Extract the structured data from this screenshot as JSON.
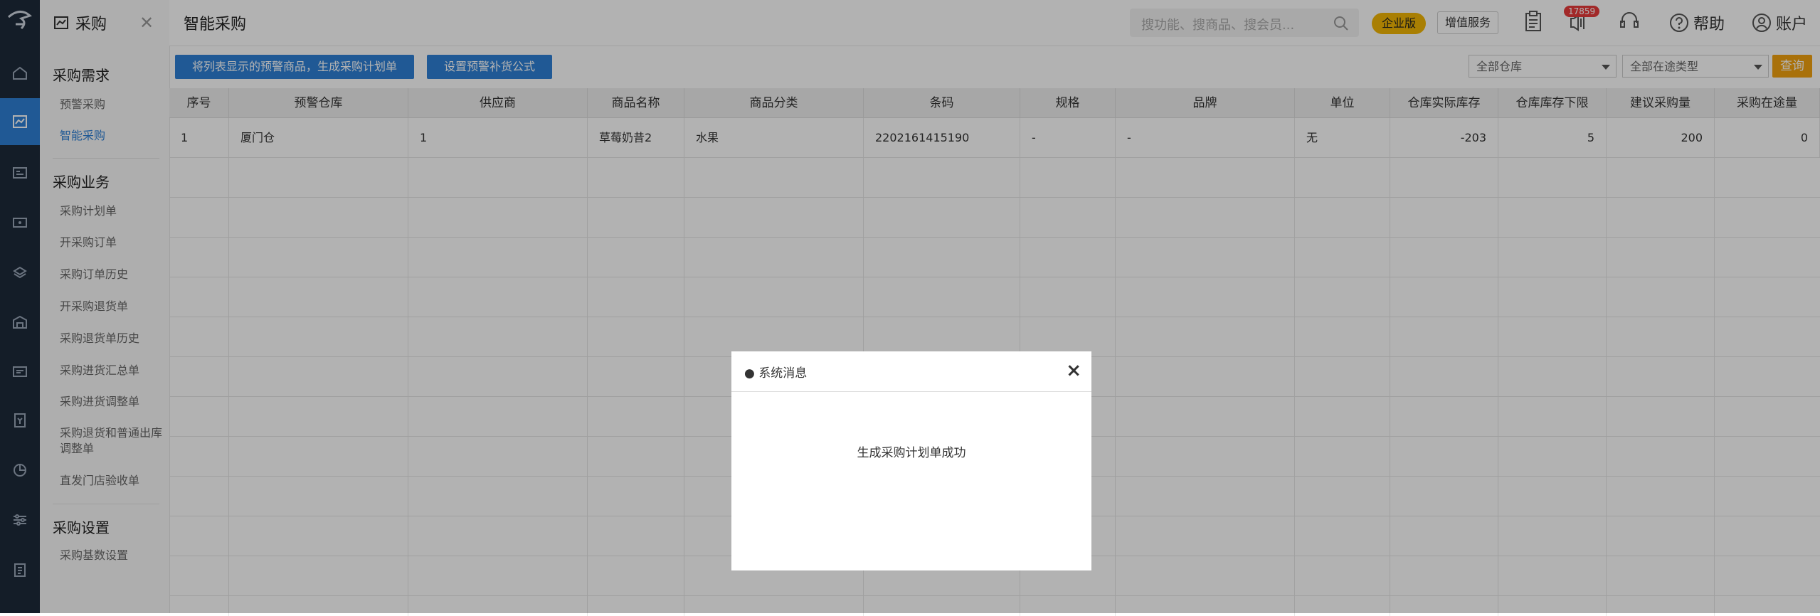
{
  "sidebar": {
    "module_title": "采购",
    "groups": [
      {
        "title": "采购需求",
        "items": [
          "预警采购",
          "智能采购"
        ]
      },
      {
        "title": "采购业务",
        "items": [
          "采购计划单",
          "开采购订单",
          "采购订单历史",
          "开采购退货单",
          "采购退货单历史",
          "采购进货汇总单",
          "采购进货调整单",
          "采购退货和普通出库调整单",
          "直发门店验收单"
        ]
      },
      {
        "title": "采购设置",
        "items": [
          "采购基数设置"
        ]
      }
    ]
  },
  "header": {
    "page_title": "智能采购",
    "search_placeholder": "搜功能、搜商品、搜会员...",
    "edition_badge": "企业版",
    "value_added": "增值服务",
    "notification_count": "17859",
    "help": "帮助",
    "account": "账户"
  },
  "toolbar": {
    "generate_plan": "将列表显示的预警商品，生成采购计划单",
    "set_formula": "设置预警补货公式",
    "warehouse_filter": "全部仓库",
    "transit_filter": "全部在途类型",
    "query": "查询"
  },
  "table": {
    "columns": [
      "序号",
      "预警仓库",
      "供应商",
      "商品名称",
      "商品分类",
      "条码",
      "规格",
      "品牌",
      "单位",
      "仓库实际库存",
      "仓库库存下限",
      "建议采购量",
      "采购在途量"
    ],
    "rows": [
      [
        "1",
        "厦门仓",
        "1",
        "草莓奶昔2",
        "水果",
        "2202161415190",
        "-",
        "-",
        "无",
        "-203",
        "5",
        "200",
        "0"
      ]
    ]
  },
  "dialog": {
    "title": "● 系统消息",
    "close": "×",
    "message": "生成采购计划单成功"
  }
}
